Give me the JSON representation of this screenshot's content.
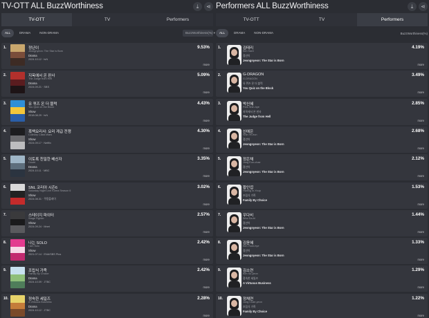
{
  "left": {
    "title": "TV-OTT ALL BuzzWorthiness",
    "tabs": [
      "TV-OTT",
      "TV",
      "Performers"
    ],
    "filters": [
      "ALL",
      "DRAMA",
      "NON-DRAMA"
    ],
    "sort_value": "BuzzWorthiness(%) ▾",
    "download_icon": "download-icon",
    "share_icon": "share-icon",
    "items": [
      {
        "rank": "1.",
        "title": "정년이",
        "subtitle": "Jeongnyeon: The Star is Born",
        "genre": "Drama",
        "meta": "2024.10.12  ·  tvN",
        "pct": "9.53%",
        "more": "more",
        "colors": [
          "#c9a76d",
          "#7a4d3a",
          "#3d2b24"
        ]
      },
      {
        "rank": "2.",
        "title": "지옥에서 온 판사",
        "subtitle": "The Judge from Hell",
        "genre": "Drama",
        "meta": "2024.09.21  ·  SBS",
        "pct": "5.09%",
        "more": "more",
        "colors": [
          "#b2302c",
          "#5a1c1f",
          "#1e1416"
        ]
      },
      {
        "rank": "3.",
        "title": "유 퀴즈 온 더 블럭",
        "subtitle": "You Quiz on the Block",
        "genre": "Show",
        "meta": "2018.08.29  ·  tvN",
        "pct": "4.43%",
        "more": "more",
        "colors": [
          "#2f8fd6",
          "#f3c63a",
          "#2a5ea8"
        ]
      },
      {
        "rank": "4.",
        "title": "흑백요리사: 요리 계급 전쟁",
        "subtitle": "Culinary Class Wars",
        "genre": "Show",
        "meta": "2024.09.17  ·  Netflix",
        "pct": "4.30%",
        "more": "more",
        "colors": [
          "#1d1d1f",
          "#6b6b6e",
          "#bdbdbf"
        ]
      },
      {
        "rank": "5.",
        "title": "이토록 친밀한 배신자",
        "subtitle": "Doubt",
        "genre": "Drama",
        "meta": "2024.10.11  ·  MBC",
        "pct": "3.35%",
        "more": "more",
        "colors": [
          "#9fb6c7",
          "#5d6e7c",
          "#2b3440"
        ]
      },
      {
        "rank": "6.",
        "title": "SNL 코리아 시즌6",
        "subtitle": "Saturday Night Live Korea Season 6",
        "genre": "Show",
        "meta": "2024.08.31  ·  쿠팡플레이",
        "pct": "3.02%",
        "more": "more",
        "colors": [
          "#d9d9d9",
          "#222222",
          "#c42b2b"
        ]
      },
      {
        "rank": "7.",
        "title": "스테이지 파이터",
        "subtitle": "Stage Fighter",
        "genre": "Show",
        "meta": "2024.09.24  ·  Mnet",
        "pct": "2.57%",
        "more": "more",
        "colors": [
          "#3a3a3c",
          "#1a1a1c",
          "#5a5a5e"
        ]
      },
      {
        "rank": "8.",
        "title": "나는 SOLO",
        "subtitle": "I am Solo",
        "genre": "Show",
        "meta": "2021.07.14  ·  ENA/SBS Plus",
        "pct": "2.42%",
        "more": "more",
        "colors": [
          "#e33b8f",
          "#f7d9e7",
          "#c22a6f"
        ]
      },
      {
        "rank": "9.",
        "title": "조립식 가족",
        "subtitle": "Family By Choice",
        "genre": "Drama",
        "meta": "2024.10.09  ·  JTBC",
        "pct": "2.42%",
        "more": "more",
        "colors": [
          "#c8e1ef",
          "#8fbf7a",
          "#4f7d5a"
        ]
      },
      {
        "rank": "10.",
        "title": "정숙한 세일즈",
        "subtitle": "A Virtuous Business",
        "genre": "Drama",
        "meta": "2024.10.12  ·  JTBC",
        "pct": "2.28%",
        "more": "more",
        "colors": [
          "#e7d36a",
          "#c47c3a",
          "#7a4a2a"
        ]
      }
    ]
  },
  "right": {
    "title": "Performers ALL BuzzWorthiness",
    "tabs": [
      "TV-OTT",
      "TV",
      "Performers"
    ],
    "filters": [
      "ALL",
      "DRAMA",
      "NON-DRAMA"
    ],
    "sort_label": "BuzzWorthiness(%)",
    "download_icon": "download-icon",
    "share_icon": "share-icon",
    "items": [
      {
        "rank": "1.",
        "name": "김태리",
        "name_en": "Kim Taeri",
        "show_ko": "정년이",
        "show_en": "Jeongnyeon: The Star is Born",
        "pct": "4.19%",
        "more": "more"
      },
      {
        "rank": "2.",
        "name": "G-DRAGON",
        "name_en": "G-DRAGON",
        "show_ko": "유 퀴즈 온 더 블럭",
        "show_en": "You Quiz on the Block",
        "pct": "3.49%",
        "more": "more"
      },
      {
        "rank": "3.",
        "name": "박신혜",
        "name_en": "Park Shin-hye",
        "show_ko": "지옥에서 온 판사",
        "show_en": "The Judge from Hell",
        "pct": "2.85%",
        "more": "more"
      },
      {
        "rank": "4.",
        "name": "신예은",
        "name_en": "Shin Ye-eun",
        "show_ko": "정년이",
        "show_en": "Jeongnyeon: The Star is Born",
        "pct": "2.68%",
        "more": "more"
      },
      {
        "rank": "5.",
        "name": "정은채",
        "name_en": "Jung Eun-chae",
        "show_ko": "정년이",
        "show_en": "Jeongnyeon: The Star is Born",
        "pct": "2.12%",
        "more": "more"
      },
      {
        "rank": "6.",
        "name": "황인엽",
        "name_en": "Hwang In-Youp",
        "show_ko": "조립식 가족",
        "show_en": "Family By Choice",
        "pct": "1.53%",
        "more": "more"
      },
      {
        "rank": "7.",
        "name": "우다비",
        "name_en": "Woo Da-bi",
        "show_ko": "정년이",
        "show_en": "Jeongnyeon: The Star is Born",
        "pct": "1.44%",
        "more": "more"
      },
      {
        "rank": "8.",
        "name": "김윤혜",
        "name_en": "Kim Yoon-hye",
        "show_ko": "정년이",
        "show_en": "Jeongnyeon: The Star is Born",
        "pct": "1.33%",
        "more": "more"
      },
      {
        "rank": "9.",
        "name": "김소연",
        "name_en": "Kim So-yeon",
        "show_ko": "정숙한 세일즈",
        "show_en": "A Virtuous Business",
        "pct": "1.29%",
        "more": "more"
      },
      {
        "rank": "10.",
        "name": "정채연",
        "name_en": "Jung Chae-yeon",
        "show_ko": "조립식 가족",
        "show_en": "Family By Choice",
        "pct": "1.22%",
        "more": "more"
      }
    ]
  }
}
